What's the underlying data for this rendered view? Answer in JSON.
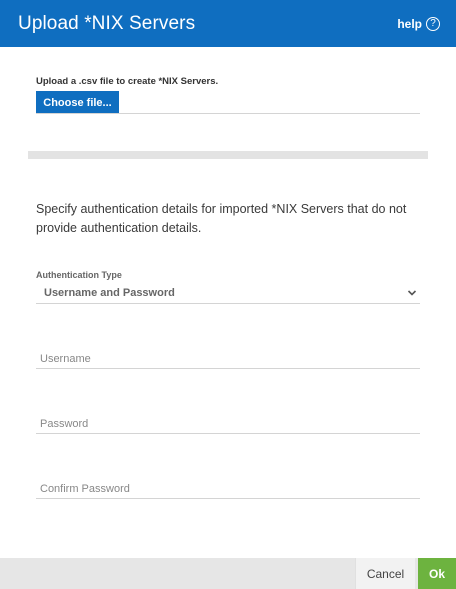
{
  "dialog": {
    "title": "Upload *NIX Servers",
    "help_label": "help",
    "help_icon_glyph": "?"
  },
  "upload": {
    "label": "Upload a .csv file to create *NIX Servers.",
    "choose_button": "Choose file..."
  },
  "auth": {
    "description": "Specify authentication details for imported *NIX Servers that do not provide authentication details.",
    "type_label": "Authentication Type",
    "type_value": "Username and Password",
    "fields": {
      "username_placeholder": "Username",
      "password_placeholder": "Password",
      "confirm_password_placeholder": "Confirm Password"
    }
  },
  "footer": {
    "cancel_label": "Cancel",
    "ok_label": "Ok"
  },
  "colors": {
    "header_bg": "#0f6ec0",
    "primary_button": "#0f6ec0",
    "ok_button": "#6db33f",
    "footer_bg": "#e6e6e6"
  }
}
